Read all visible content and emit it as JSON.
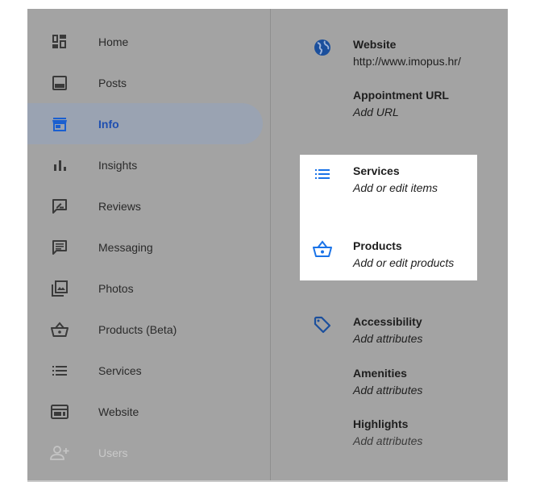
{
  "sidebar": {
    "items": [
      {
        "label": "Home",
        "icon": "dashboard-icon"
      },
      {
        "label": "Posts",
        "icon": "posts-icon"
      },
      {
        "label": "Info",
        "icon": "storefront-icon",
        "active": true
      },
      {
        "label": "Insights",
        "icon": "bar-chart-icon"
      },
      {
        "label": "Reviews",
        "icon": "rate-review-icon"
      },
      {
        "label": "Messaging",
        "icon": "message-icon"
      },
      {
        "label": "Photos",
        "icon": "photo-library-icon"
      },
      {
        "label": "Products (Beta)",
        "icon": "shopping-basket-icon"
      },
      {
        "label": "Services",
        "icon": "list-icon"
      },
      {
        "label": "Website",
        "icon": "web-icon"
      },
      {
        "label": "Users",
        "icon": "add-user-icon",
        "disabled": true
      }
    ]
  },
  "detail": {
    "website": {
      "title": "Website",
      "value": "http://www.imopus.hr/"
    },
    "appointment": {
      "title": "Appointment URL",
      "value": "Add URL"
    },
    "services": {
      "title": "Services",
      "value": "Add or edit items"
    },
    "products": {
      "title": "Products",
      "value": "Add or edit products"
    },
    "accessibility": {
      "title": "Accessibility",
      "value": "Add attributes"
    },
    "amenities": {
      "title": "Amenities",
      "value": "Add attributes"
    },
    "highlights": {
      "title": "Highlights",
      "value": "Add attributes"
    }
  },
  "colors": {
    "overlay": "#a3a3a3",
    "accent_blue": "#1a73e8",
    "active_text": "#1f4fb0"
  }
}
